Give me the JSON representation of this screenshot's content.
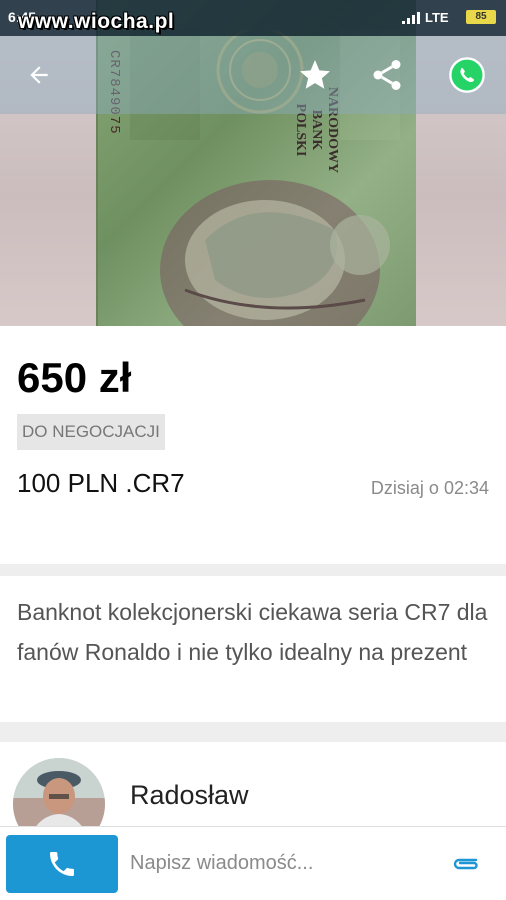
{
  "status_bar": {
    "time": "6:45",
    "network": "LTE",
    "battery": "85",
    "watermark": "www.wiocha.pl"
  },
  "app_bar": {
    "icons": [
      "back-arrow-icon",
      "star-icon",
      "share-icon",
      "whatsapp-icon"
    ]
  },
  "listing": {
    "price": "650 zł",
    "negotiable_badge": "DO NEGOCJACJI",
    "title": "100 PLN .CR7",
    "date": "Dzisiaj o 02:34",
    "description": "Banknot kolekcjonerski ciekawa seria CR7 dla fanów Ronaldo i nie tylko idealny na prezent"
  },
  "seller": {
    "name": "Radosław"
  },
  "bottom_bar": {
    "message_placeholder": "Napisz wiadomość..."
  },
  "colors": {
    "accent": "#1d96d4",
    "badge_bg": "#e6e6e6",
    "whatsapp": "#25d366"
  }
}
